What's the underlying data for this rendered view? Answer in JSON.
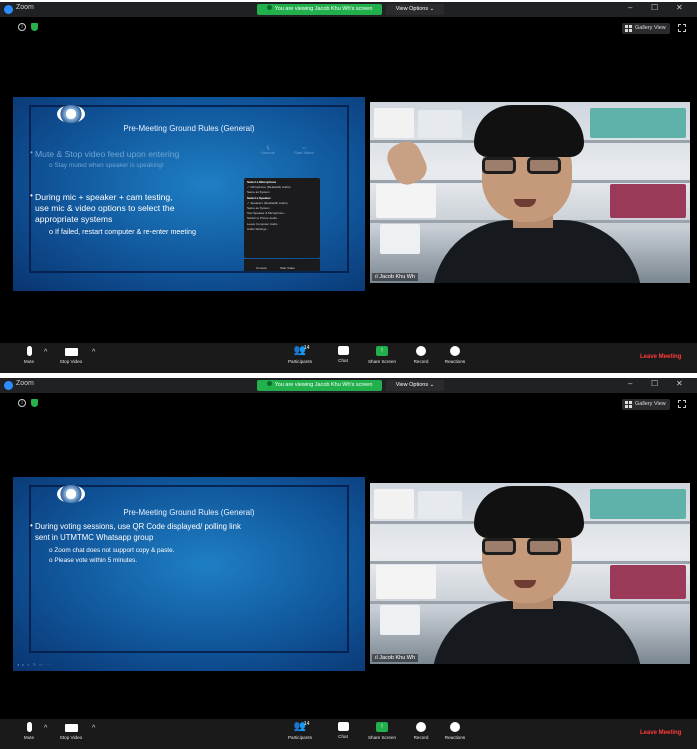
{
  "window": {
    "app_title": "Zoom",
    "share_banner": "You are viewing Jacob Khu Wh's screen",
    "view_options": "View Options",
    "gallery_view": "Gallery View",
    "controls": {
      "minimize": "–",
      "maximize": "☐",
      "close": "✕"
    }
  },
  "toolbar": {
    "mute": "Mute",
    "stop_video": "Stop Video",
    "participants": "Participants",
    "participants_count": "14",
    "chat": "Chat",
    "share_screen": "Share Screen",
    "record": "Record",
    "reactions": "Reactions",
    "leave": "Leave Meeting",
    "caret": "^"
  },
  "video": {
    "name_tag": "Jacob Khu Wh"
  },
  "slide_a": {
    "title": "Pre-Meeting Ground Rules (General)",
    "bullet1": "Mute & Stop video feed upon entering",
    "bullet1_sub": "Stay muted when speaker is speaking!",
    "bullet2_l1": "During mic + speaker + cam testing,",
    "bullet2_l2": "use mic & video options to select the",
    "bullet2_l3": "appropriate systems",
    "bullet2_sub": "If failed, restart computer & re-enter meeting",
    "mic_label": "Unmute",
    "vid_label": "Start Video",
    "popup": [
      "Select a Microphone",
      "✓ Microphone (RealtekR) Audio)",
      "Same as System",
      "Select a Speaker",
      "✓ Speakers (RealtekR) Audio)",
      "Same as System",
      "Test Speaker & Microphone...",
      "Switch to Phone Audio...",
      "Leave Computer Audio",
      "Audio Settings..."
    ],
    "popup_bar_left": "Unmute",
    "popup_bar_right": "Start Video"
  },
  "slide_b": {
    "title": "Pre-Meeting Ground Rules (General)",
    "bullet1_l1": "During voting sessions, use QR Code displayed/ polling link",
    "bullet1_l2": "sent in UTMTMC Whatsapp group",
    "sub1": "Zoom chat does not support copy & paste.",
    "sub2": "Please vote within 5 minutes.",
    "nav": "◂ ▸ ⌕ ✎ ▭ ⋯"
  },
  "colors": {
    "share_green": "#22b04c",
    "leave_red": "#ff3b3b",
    "slide_blue": "#10559a"
  }
}
